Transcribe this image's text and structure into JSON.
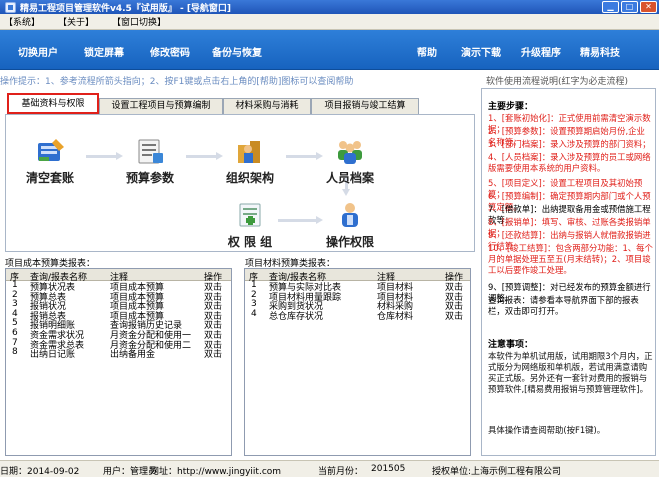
{
  "titlebar": {
    "title": "精易工程项目管理软件v4.5『试用版』 - [导航窗口]"
  },
  "menubar": {
    "items": [
      "【系统】",
      "【关于】",
      "【窗口切换】"
    ]
  },
  "toolbar": {
    "left": [
      "切换用户",
      "锁定屏幕",
      "修改密码",
      "备份与恢复"
    ],
    "right": [
      "帮助",
      "演示下载",
      "升级程序",
      "精易科技"
    ]
  },
  "hint": "操作提示：1、参考流程所箭头指向；2、按F1键或点击右上角的[帮助]图标可以查阅帮助",
  "tabs": [
    "基础资料与权限",
    "设置工程项目与预算编制",
    "材料采购与消耗",
    "项目报销与竣工结算"
  ],
  "flow": {
    "nodes": [
      "清空套账",
      "预算参数",
      "组织架构",
      "人员档案",
      "权 限 组",
      "操作权限"
    ]
  },
  "reports_left": {
    "title": "项目成本预算类报表：",
    "headers": [
      "序",
      "查询/报表名称",
      "注释",
      "操作"
    ],
    "rows": [
      [
        "1",
        "预算状况表",
        "项目成本预算",
        "双击"
      ],
      [
        "2",
        "预算总表",
        "项目成本预算",
        "双击"
      ],
      [
        "3",
        "报销状况",
        "项目成本预算",
        "双击"
      ],
      [
        "4",
        "报销总表",
        "项目成本预算",
        "双击"
      ],
      [
        "5",
        "报销明细账",
        "查询报销历史记录",
        "双击"
      ],
      [
        "6",
        "资金需求状况",
        "月资金分配和使用一",
        "双击"
      ],
      [
        "7",
        "资金需求总表",
        "月资金分配和使用二",
        "双击"
      ],
      [
        "8",
        "出纳日记账",
        "出纳备用金",
        "双击"
      ]
    ]
  },
  "reports_right": {
    "title": "项目材料预算类报表：",
    "headers": [
      "序",
      "查询/报表名称",
      "注释",
      "操作"
    ],
    "rows": [
      [
        "1",
        "预算与实际对比表",
        "项目材料",
        "双击"
      ],
      [
        "2",
        "项目材料用量跟踪",
        "项目材料",
        "双击"
      ],
      [
        "3",
        "采购到货状况",
        "材料采购",
        "双击"
      ],
      [
        "4",
        "总仓库存状况",
        "仓库材料",
        "双击"
      ]
    ]
  },
  "side": {
    "title": "软件使用流程说明(红字为必走流程)",
    "steps_head": "主要步骤：",
    "steps": [
      "1、[套账初始化]：正式使用前需清空演示数据；",
      "2、[预算参数]：设置预算期启始月份,企业名称等。",
      "3、[部门档案]：录入涉及预算的部门资料；",
      "4、[人员档案]：录入涉及预算的员工或网络版需要使用本系统的用户资料。",
      "5、[项目定义]：设置工程项目及其初始预算；",
      "6、[预算编制]：确定预算期内部门或个人预算定额。",
      "7、[借款单]：出纳提取备用金或预借施工程款等；",
      "8、[报销单]：填写、审核、过账各类报销单据；",
      "9、[还款结算]：出纳与报销人就借款报销进行结算",
      "10、[竣工结算]：包含两部分功能：1、每个月的单据处理五至五(月末结转)；2、项目竣工以后要作竣工处理。",
      "9、[预算调整]：对已经发布的预算金额进行调整。",
      "查询报表：请参看本导航界面下部的报表栏，双击即可打开。"
    ],
    "note_head": "注意事项：",
    "notes": "本软件为单机试用版，试用期限3个月内，正式版分为网络版和单机版，若试用满意请购买正式版。另外还有一套针对费用的报销与预算软件,[精易费用报销与预算管理软件]。",
    "notes2": "具体操作请查阅帮助(按F1键)。"
  },
  "status": {
    "date": "日期：2014-09-02",
    "user": "用户：管理员",
    "url": "网址：http://www.jingyiit.com",
    "month_label": "当前月份：",
    "month": "201505",
    "license": "授权单位:上海示例工程有限公司"
  }
}
